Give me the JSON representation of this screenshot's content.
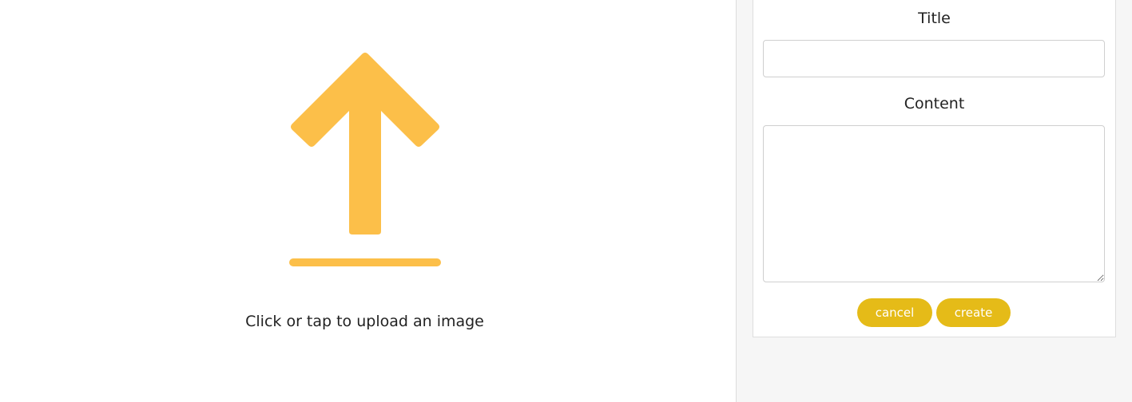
{
  "upload": {
    "icon": "upload-arrow-icon",
    "caption": "Click or tap to upload an image",
    "accent_color": "#fcbf49"
  },
  "form": {
    "title_label": "Title",
    "title_value": "",
    "content_label": "Content",
    "content_value": "",
    "cancel_label": "cancel",
    "create_label": "create",
    "button_color": "#e5bb18"
  }
}
